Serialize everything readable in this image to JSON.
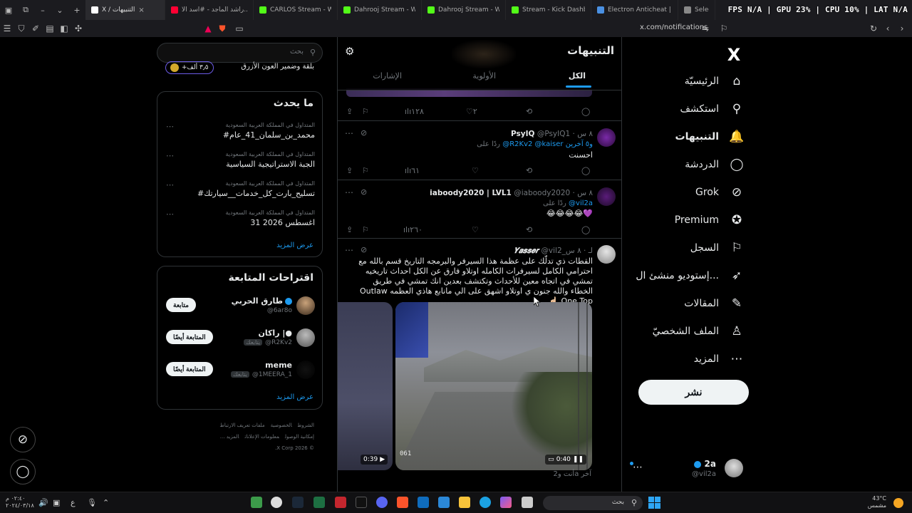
{
  "browser": {
    "tabs": [
      {
        "label": "X / التنبيهات",
        "active": true,
        "favicon_color": "#ffffff"
      },
      {
        "label": "راشد الماجد - #أسد الأ...",
        "favicon_color": "#ff0033"
      },
      {
        "label": "CARLOS Stream - Wa...",
        "favicon_color": "#53fc18"
      },
      {
        "label": "Dahrooj Stream - Watc...",
        "favicon_color": "#53fc18"
      },
      {
        "label": "Dahrooj Stream - Watch Li...",
        "favicon_color": "#53fc18"
      },
      {
        "label": "Stream - Kick Dashboard",
        "favicon_color": "#53fc18"
      },
      {
        "label": "Electron Anticheat | The #...",
        "favicon_color": "#4a90e2"
      },
      {
        "label": "Select ...",
        "favicon_color": "#888888"
      }
    ],
    "perf_overlay": "FPS N/A | GPU 23% | CPU 10% | LAT N/A",
    "url": "x.com/notifications"
  },
  "nav": {
    "logo": "X",
    "items": [
      {
        "label": "الرئيسيّة",
        "icon": "home-icon",
        "glyph": "⌂"
      },
      {
        "label": "استكشف",
        "icon": "search-icon",
        "glyph": "⚲"
      },
      {
        "label": "التنبيهات",
        "icon": "bell-icon",
        "glyph": "🔔",
        "active": true
      },
      {
        "label": "الدردشة",
        "icon": "chat-icon",
        "glyph": "◯"
      },
      {
        "label": "Grok",
        "icon": "grok-icon",
        "glyph": "⊘"
      },
      {
        "label": "Premium",
        "icon": "premium-icon",
        "glyph": "✪"
      },
      {
        "label": "السجل",
        "icon": "bookmark-icon",
        "glyph": "⚐"
      },
      {
        "label": "إستوديو منشئ ال...",
        "icon": "rocket-icon",
        "glyph": "➶"
      },
      {
        "label": "المقالات",
        "icon": "article-icon",
        "glyph": "✎"
      },
      {
        "label": "الملف الشخصيّ",
        "icon": "profile-icon",
        "glyph": "♙"
      },
      {
        "label": "المزيد",
        "icon": "more-icon",
        "glyph": "⋯"
      }
    ],
    "post_button": "نشر",
    "account": {
      "name": "2a",
      "handle": "@vil2a"
    }
  },
  "main": {
    "title": "التنبيهات",
    "tabs": [
      "الكل",
      "الأولوية",
      "الإشارات"
    ],
    "posts": [
      {
        "kind": "stub",
        "stats": {
          "replies": "",
          "reposts": "",
          "likes": "٢",
          "views": "١٢٨"
        }
      },
      {
        "name": "PsyIQ",
        "handle": "@PsyIQ1",
        "time": "٨ س",
        "reply_prefix": "ردًا على",
        "mentions": "@R2Kv2 @kaiser",
        "others": "و٥ آخرين",
        "text": "احسنت",
        "stats": {
          "replies": "",
          "reposts": "",
          "likes": "",
          "views": "٦١"
        }
      },
      {
        "name": "iaboody2020 | LVL1",
        "handle": "@iaboody2020",
        "time": "٨ س",
        "reply_prefix": "ردًا على",
        "mentions": "@vil2a",
        "others": "",
        "text": "💜😂😂😂😂",
        "stats": {
          "replies": "",
          "reposts": "",
          "likes": "",
          "views": "٢٦٠"
        }
      },
      {
        "name": "𝒀𝒂𝒔𝒔𝒆𝒓",
        "handle": "@vil2_لـ",
        "time": "٨ س",
        "text": "القطات ذي تدلّك على عظمة هذا السيرفر والبرمجه التاريخ قسم بالله مع احترامي الكامل لسيرفرات الكامله اوتلاو فارق عن الكل احداث تاريخيه تمشي في اتجاه معين للأحداث وتكتشف بعدين انك تمشي في طريق الخطاء والله جنون ي اوتلاو اشهق على الي مانابع هاذي العظمه Outlaw One Top ☝🏻",
        "video_left_duration": "0:39",
        "video_right_duration": "0:40",
        "hud_value": "061",
        "reply_note": "أنت و2a آخر"
      }
    ]
  },
  "side": {
    "search_placeholder": "بحث",
    "promo": {
      "title": "بلقة وضمير العون الأزرق",
      "pill": "+٣٫٥ ألف"
    },
    "trends_title": "ما يحدث",
    "trends": [
      {
        "context": "المتداول في المملكة العربية السعودية",
        "name": "#محمد_بن_سلمان_41_عام"
      },
      {
        "context": "المتداول في المملكة العربية السعودية",
        "name": "الجبة الاستراتيجية السياسية"
      },
      {
        "context": "المتداول في المملكة العربية السعودية",
        "name": "#تسليح_بارت_كل_خدمات__سيارتك"
      },
      {
        "context": "المتداول في المملكة العربية السعودية",
        "name": "اغسطس 2026 31"
      }
    ],
    "show_more": "عرض المزيد",
    "who_title": "اقتراحات المتابعة",
    "who": [
      {
        "name": "طارق الحربي",
        "handle": "@6ar8o",
        "badge": "",
        "button": "متابعة",
        "verified": true
      },
      {
        "name": "راكان |●",
        "handle": "@R2Kv2",
        "badge": "يتابعك",
        "button": "المتابعة أيضًا",
        "verified": false
      },
      {
        "name": "meme",
        "handle": "@1MEERA_1",
        "badge": "يتابعك",
        "button": "المتابعة أيضًا",
        "verified": false
      }
    ],
    "footer": [
      "الشروط",
      "الخصوصية",
      "ملفات تعريف الارتباط",
      "إمكانية الوصول",
      "معلومات الإعلانات",
      "المزيد ...",
      "© 2026 X Corp."
    ]
  },
  "taskbar": {
    "clock_time": "٠٢:٤٠ م",
    "clock_date": "٢٠٢٤/٠٣/١٨",
    "lang": "ع",
    "search": "بحث",
    "weather_temp": "43°C",
    "weather_desc": "مشمس"
  }
}
